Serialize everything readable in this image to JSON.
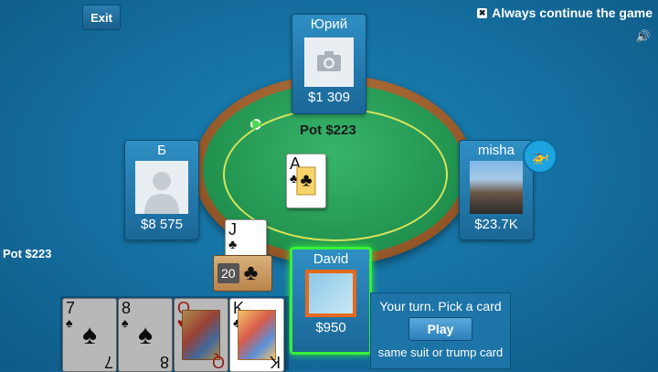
{
  "toolbar": {
    "exit_label": "Exit"
  },
  "options": {
    "always_continue_label": "Always continue the game",
    "always_continue_checked": true,
    "sound_icon": "speaker-icon"
  },
  "pot": {
    "center_label": "Pot $223",
    "side_label": "Pot $223"
  },
  "players": {
    "top": {
      "name": "Юрий",
      "money": "$1 309",
      "avatar": "camera-placeholder"
    },
    "left": {
      "name": "Б",
      "money": "$8 575",
      "avatar": "silhouette-placeholder"
    },
    "right": {
      "name": "misha",
      "money": "$23.7K",
      "avatar": "photo",
      "badge": "helicopter-icon"
    },
    "self": {
      "name": "David",
      "money": "$950",
      "active": true
    }
  },
  "table_card": {
    "rank": "A",
    "suit": "♣"
  },
  "trump": {
    "card_rank": "J",
    "card_suit": "♣",
    "deck_count": "20",
    "deck_suit": "♣"
  },
  "hand": [
    {
      "rank": "7",
      "suit": "♠",
      "color": "black"
    },
    {
      "rank": "8",
      "suit": "♠",
      "color": "black"
    },
    {
      "rank": "Q",
      "suit": "♥",
      "color": "red"
    },
    {
      "rank": "K",
      "suit": "♣",
      "color": "black"
    }
  ],
  "turn": {
    "title": "Your turn. Pick a card",
    "play_label": "Play",
    "hint": "same suit or trump card"
  },
  "colors": {
    "active_border": "#38f03a",
    "felt": "#1f8f4c",
    "background": "#146e9f"
  }
}
